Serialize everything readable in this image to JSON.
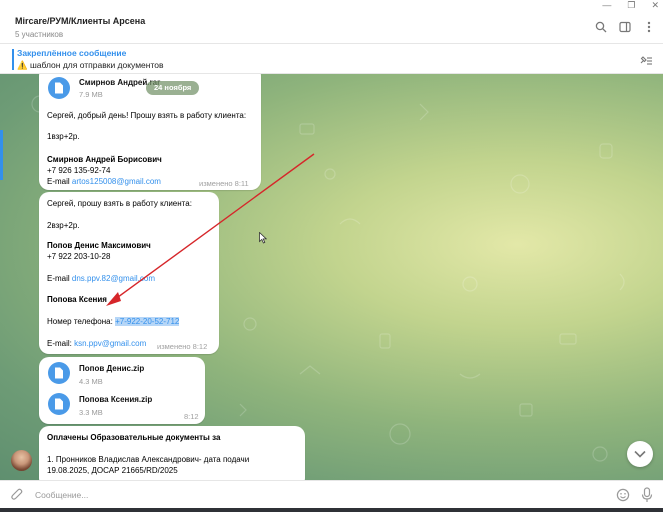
{
  "window": {
    "minimize": "—",
    "restore": "❐",
    "close": "✕"
  },
  "header": {
    "title": "Mircare/РУМ/Клиенты Арсена",
    "subtitle": "5 участников",
    "icons": [
      "search-icon",
      "sidebar-toggle-icon",
      "more-icon"
    ]
  },
  "pinned": {
    "label": "Закреплённое сообщение",
    "emoji": "⚠️",
    "text": "шаблон для отправки документов"
  },
  "date_pill": "24 ноября",
  "messages": {
    "m1": {
      "file_name": "Смирнов Андрей.rar",
      "file_size": "7.9 MB",
      "text1": "Сергей, добрый день!  Прошу взять в работу клиента:",
      "text2": "1взр+2р.",
      "name": "Смирнов Андрей Борисович",
      "phone": "+7 926 135-92-74",
      "email_label": "E-mail ",
      "email": "artos125008@gmail.com",
      "meta": "изменено 8:11"
    },
    "m2": {
      "text1": "Сергей, прошу взять в работу клиента:",
      "text2": "2взр+2р.",
      "name1": "Попов Денис Максимович",
      "phone1": "+7 922 203-10-28",
      "email1_label": "E-mail ",
      "email1": "dns.ppv.82@gmail.com",
      "name2": "Попова Ксения",
      "phone2_label": "Номер телефона: ",
      "phone2": "+7-922-20-52-712",
      "email2_label": "E-mail:  ",
      "email2": "ksn.ppv@gmail.com",
      "meta": "изменено 8:12"
    },
    "m3": {
      "file1_name": "Попов Денис.zip",
      "file1_size": "4.3 MB",
      "file2_name": "Попова Ксения.zip",
      "file2_size": "3.3 MB",
      "meta": "8:12"
    },
    "m4": {
      "title": "Оплачены Образовательные документы за",
      "line1": "1. Пронников Владислав Александрович- дата подачи",
      "line2": "19.08.2025, ДОСАР 21665/RD/2025"
    }
  },
  "composer": {
    "placeholder": "Сообщение..."
  },
  "colors": {
    "accent": "#3390ec",
    "annotation_arrow": "#d6262a"
  }
}
